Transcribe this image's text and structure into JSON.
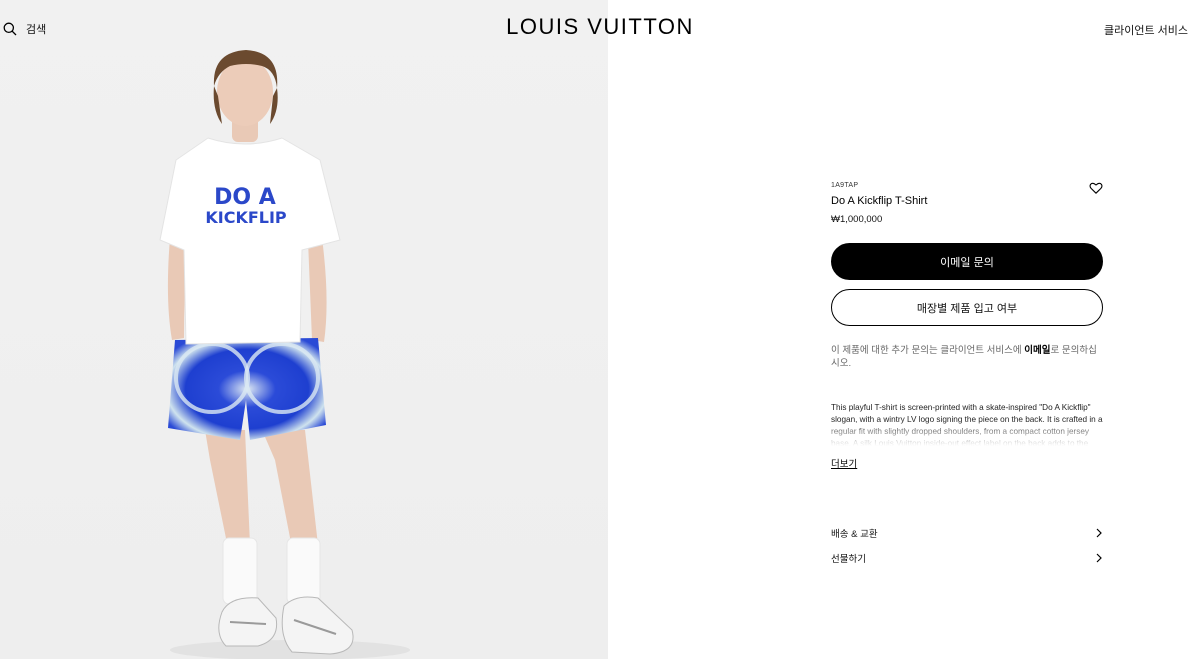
{
  "header": {
    "search_label": "검색",
    "brand": "LOUIS VUITTON",
    "client_service": "클라이언트 서비스"
  },
  "product": {
    "sku": "1A9TAP",
    "name": "Do A Kickflip T-Shirt",
    "price": "₩1,000,000",
    "image_print_line1": "DO A",
    "image_print_line2": "KICKFLIP"
  },
  "actions": {
    "email_inquiry": "이메일 문의",
    "store_availability": "매장별 제품 입고 여부"
  },
  "inquiry": {
    "before": "이 제품에 대한 추가 문의는 클라이언트 서비스에 ",
    "highlight": "이메일",
    "after": "로 문의하십시오."
  },
  "description": {
    "text": "This playful T-shirt is screen-printed with a skate-inspired \"Do A Kickflip\" slogan, with a wintry LV logo signing the piece on the back. It is crafted in a regular fit with slightly dropped shoulders, from a compact cotton jersey base. A silk Louis Vuitton inside-out effect label on the back adds to the",
    "more": "더보기"
  },
  "accordion": [
    {
      "label": "배송 & 교환",
      "icon": "chevron-right-icon"
    },
    {
      "label": "선물하기",
      "icon": "chevron-right-icon"
    }
  ],
  "colors": {
    "image_background": "#efefef",
    "shorts_blue": "#2b4bd8",
    "button_primary": "#000000"
  }
}
